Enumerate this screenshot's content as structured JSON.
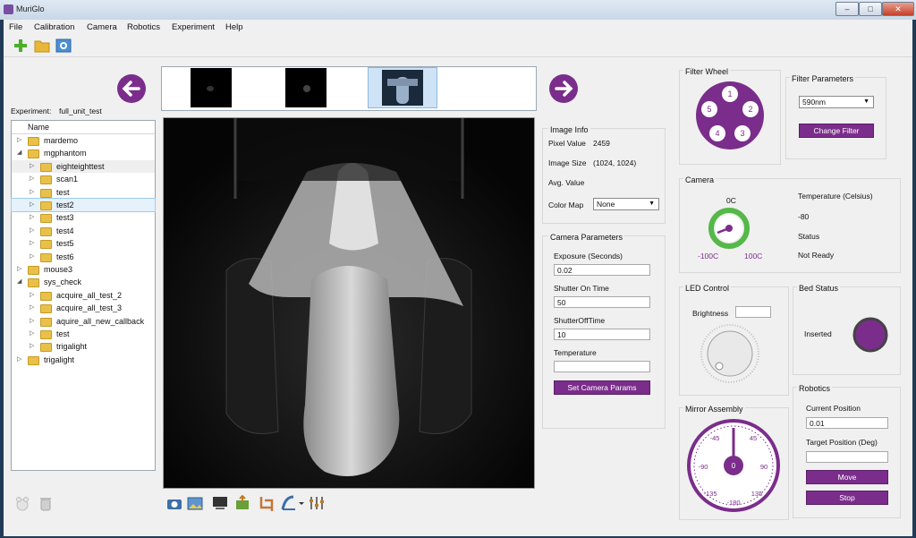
{
  "window": {
    "title": "MuriGlo",
    "minimize": "–",
    "maximize": "□",
    "close": "✕"
  },
  "menu": [
    "File",
    "Calibration",
    "Camera",
    "Robotics",
    "Experiment",
    "Help"
  ],
  "toolbar": {
    "icons": [
      "plus-icon",
      "folder-icon",
      "settings-icon"
    ]
  },
  "experiment": {
    "label": "Experiment:",
    "name": "full_unit_test"
  },
  "tree": {
    "header": "Name",
    "items": [
      {
        "label": "mardemo",
        "level": 0,
        "expander": "▷"
      },
      {
        "label": "mgphantom",
        "level": 0,
        "expander": "◢"
      },
      {
        "label": "eighteighttest",
        "level": 1,
        "expander": "▷"
      },
      {
        "label": "scan1",
        "level": 1,
        "expander": "▷"
      },
      {
        "label": "test",
        "level": 1,
        "expander": "▷"
      },
      {
        "label": "test2",
        "level": 1,
        "expander": "▷"
      },
      {
        "label": "test3",
        "level": 1,
        "expander": "▷"
      },
      {
        "label": "test4",
        "level": 1,
        "expander": "▷"
      },
      {
        "label": "test5",
        "level": 1,
        "expander": "▷"
      },
      {
        "label": "test6",
        "level": 1,
        "expander": "▷"
      },
      {
        "label": "mouse3",
        "level": 0,
        "expander": "▷"
      },
      {
        "label": "sys_check",
        "level": 0,
        "expander": "◢"
      },
      {
        "label": "acquire_all_test_2",
        "level": 1,
        "expander": "▷"
      },
      {
        "label": "acquire_all_test_3",
        "level": 1,
        "expander": "▷"
      },
      {
        "label": "aquire_all_new_callback",
        "level": 1,
        "expander": "▷"
      },
      {
        "label": "test",
        "level": 1,
        "expander": "▷"
      },
      {
        "label": "trigalight",
        "level": 1,
        "expander": "▷"
      },
      {
        "label": "trigalight",
        "level": 0,
        "expander": "▷"
      }
    ]
  },
  "image_info": {
    "title": "Image Info",
    "pixel_value_label": "Pixel Value",
    "pixel_value": "2459",
    "image_size_label": "Image Size",
    "image_size": "(1024, 1024)",
    "avg_label": "Avg. Value",
    "colormap_label": "Color Map",
    "colormap": "None"
  },
  "camera_params": {
    "title": "Camera Parameters",
    "exposure_label": "Exposure (Seconds)",
    "exposure": "0.02",
    "shutter_on_label": "Shutter On Time",
    "shutter_on": "50",
    "shutter_off_label": "ShutterOffTime",
    "shutter_off": "10",
    "temperature_label": "Temperature",
    "temperature": "",
    "set_button": "Set Camera Params"
  },
  "filter_wheel": {
    "title": "Filter Wheel",
    "slots": [
      "1",
      "2",
      "3",
      "4",
      "5"
    ]
  },
  "filter_params": {
    "title": "Filter Parameters",
    "filter": "590nm",
    "change_button": "Change Filter"
  },
  "camera": {
    "title": "Camera",
    "gauge_top": "0C",
    "gauge_left": "-100C",
    "gauge_right": "100C",
    "temperature_label": "Temperature (Celsius)",
    "temperature": "-80",
    "status_label": "Status",
    "status": "Not Ready"
  },
  "led": {
    "title": "LED Control",
    "brightness_label": "Brightness",
    "brightness": ""
  },
  "bed": {
    "title": "Bed Status",
    "status": "Inserted"
  },
  "mirror": {
    "title": "Mirror Assembly",
    "center": "0",
    "ticks": [
      "-45",
      "45",
      "-90",
      "90",
      "-135",
      "135",
      "-180"
    ]
  },
  "robotics": {
    "title": "Robotics",
    "current_label": "Current Position",
    "current": "0.01",
    "target_label": "Target Position (Deg)",
    "target": "",
    "move_button": "Move",
    "stop_button": "Stop"
  },
  "colors": {
    "accent": "#7b2d8b",
    "gauge_green": "#55b848"
  }
}
